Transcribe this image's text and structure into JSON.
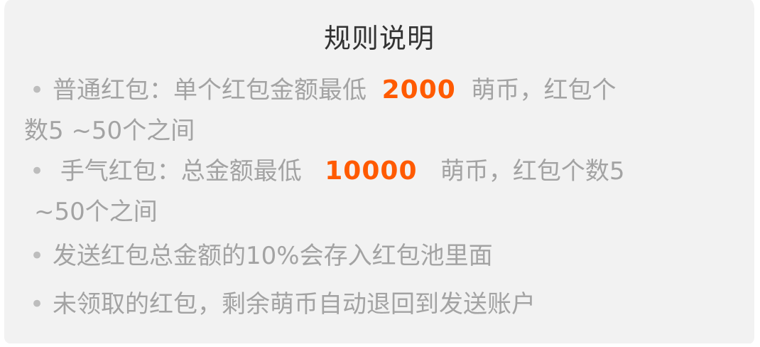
{
  "title": "规则说明",
  "rules": [
    {
      "bullet": "•",
      "line1_before": "普通红包：单个红包金额最低",
      "amount": "2000",
      "line1_after": "萌币，红包个",
      "line2": "数5 ~50个之间"
    },
    {
      "bullet": "•",
      "line1_before": "手气红包：总金额最低",
      "amount": "10000",
      "line1_after": "萌币，红包个数5",
      "line2": "~50个之间"
    },
    {
      "bullet": "•",
      "text": "发送红包总金额的10%会存入红包池里面"
    },
    {
      "bullet": "•",
      "text": "未领取的红包，剩余萌币自动退回到发送账户"
    }
  ],
  "colors": {
    "background": "#f2f2f2",
    "title": "#333333",
    "text": "#a3a3a3",
    "highlight": "#ff5a00"
  }
}
